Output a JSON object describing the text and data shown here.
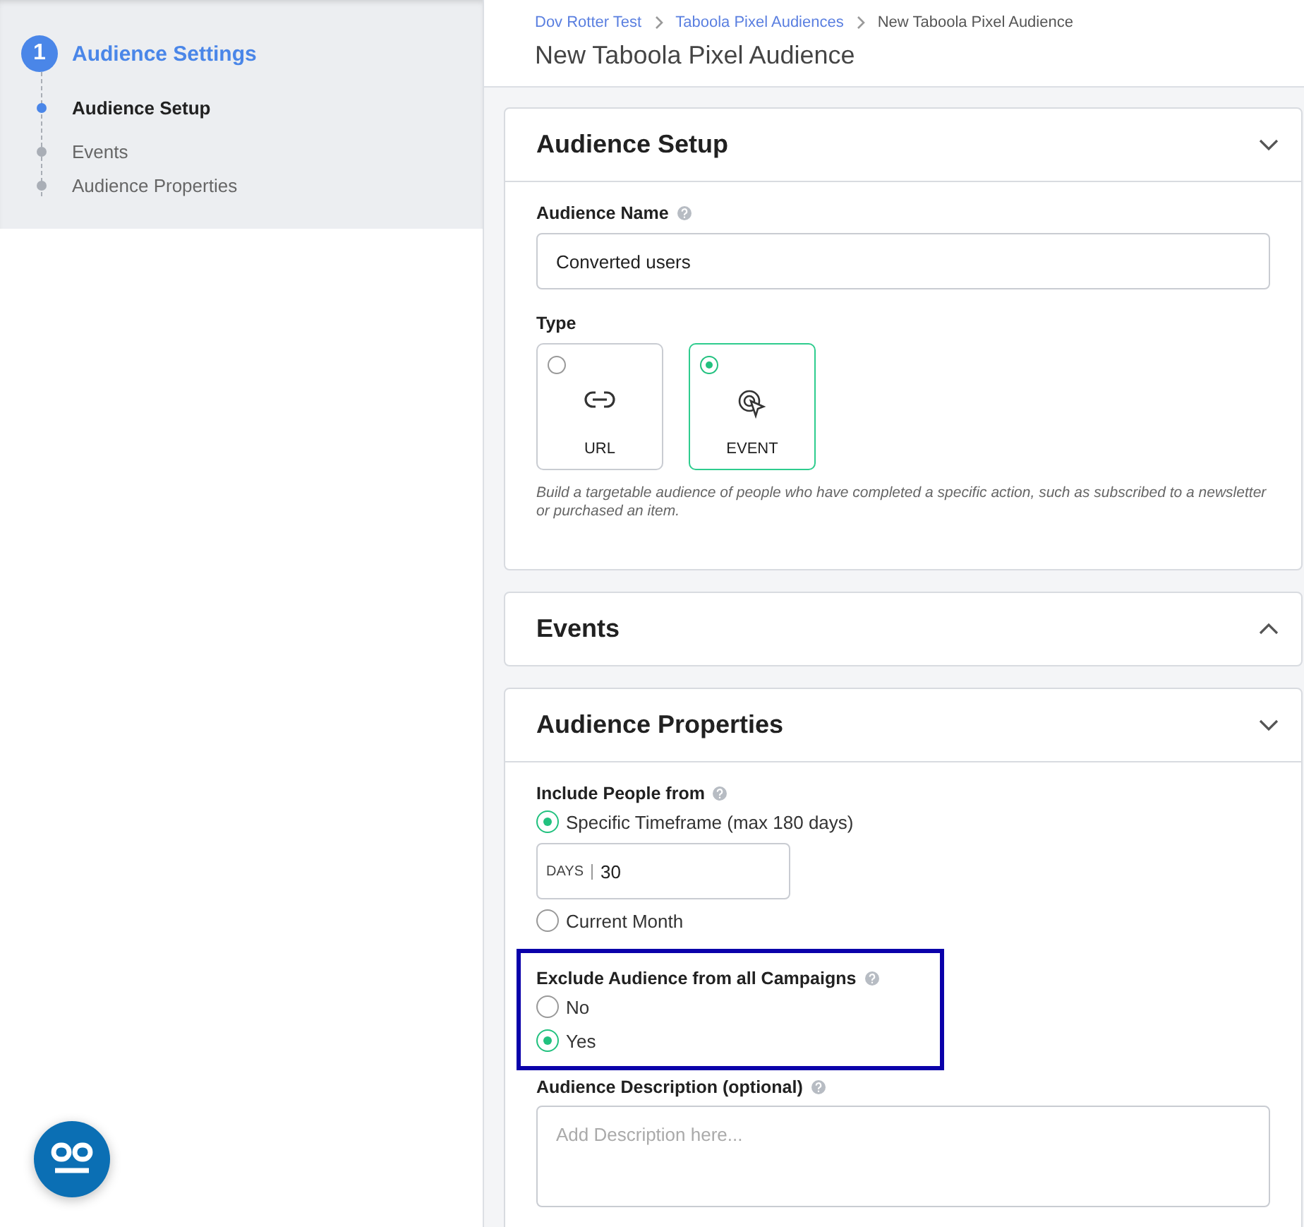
{
  "stepper": {
    "number": "1",
    "title": "Audience Settings",
    "items": [
      {
        "label": "Audience Setup",
        "selected": true
      },
      {
        "label": "Events",
        "selected": false
      },
      {
        "label": "Audience Properties",
        "selected": false
      }
    ]
  },
  "breadcrumbs": [
    {
      "label": "Dov Rotter Test",
      "kind": "link"
    },
    {
      "label": "Taboola Pixel Audiences",
      "kind": "link"
    },
    {
      "label": "New Taboola Pixel Audience",
      "kind": "current"
    }
  ],
  "page_title": "New Taboola Pixel Audience",
  "sections": [
    {
      "kind": "setup",
      "title": "Audience Setup",
      "expanded": true,
      "name_label": "Audience Name",
      "name_value": "Converted users",
      "type_label": "Type",
      "types": [
        {
          "label": "URL",
          "kind": "link",
          "selected": false
        },
        {
          "label": "EVENT",
          "kind": "cursor",
          "selected": true
        }
      ],
      "type_hint": "Build a targetable audience of people who have completed a specific action, such as subscribed to a newsletter or purchased an item."
    },
    {
      "title": "Events",
      "expanded": false
    },
    {
      "kind": "properties",
      "title": "Audience Properties",
      "expanded": true,
      "include_label": "Include People from",
      "include_options": [
        {
          "label": "Specific Timeframe (max 180 days)",
          "selected": true
        },
        {
          "label": "Current Month",
          "selected": false
        }
      ],
      "days_prefix": "DAYS",
      "days_value": "30",
      "exclude": {
        "label": "Exclude Audience from all Campaigns",
        "highlighted": true,
        "options": [
          {
            "label": "No",
            "selected": false
          },
          {
            "label": "Yes",
            "selected": true
          }
        ]
      },
      "description_label": "Audience Description (optional)",
      "description_placeholder": "Add Description here..."
    }
  ]
}
